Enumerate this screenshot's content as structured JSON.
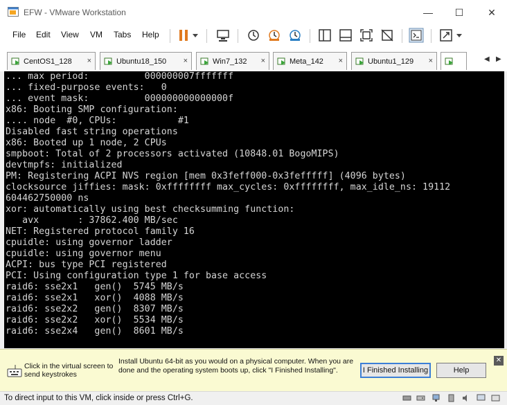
{
  "window": {
    "title": "EFW - VMware Workstation",
    "minimize_glyph": "—",
    "maximize_glyph": "☐",
    "close_glyph": "✕"
  },
  "menu": {
    "items": [
      "File",
      "Edit",
      "View",
      "VM",
      "Tabs",
      "Help"
    ]
  },
  "toolbar": {
    "icons": [
      "pause-icon",
      "dropdown-arrow-icon",
      "send-ctrl-alt-del-icon",
      "snapshot-icon",
      "revert-snapshot-icon",
      "snapshot-manager-icon",
      "show-library-icon",
      "thumbnail-view-icon",
      "full-screen-icon",
      "unity-icon",
      "console-view-icon",
      "stretch-guest-icon",
      "dropdown-arrow-icon"
    ],
    "accent_color": "#e07a1f"
  },
  "tabs": [
    {
      "label": "CentOS1_128"
    },
    {
      "label": "Ubuntu18_150"
    },
    {
      "label": "Win7_132"
    },
    {
      "label": "Meta_142"
    },
    {
      "label": "Ubuntu1_129"
    },
    {
      "label": ""
    }
  ],
  "tab_close_glyph": "×",
  "tab_nav": {
    "left": "◀",
    "right": "▶"
  },
  "console": {
    "lines": [
      "... max period:          000000007fffffff",
      "... fixed-purpose events:   0",
      "... event mask:          000000000000000f",
      "x86: Booting SMP configuration:",
      ".... node  #0, CPUs:           #1",
      "Disabled fast string operations",
      "x86: Booted up 1 node, 2 CPUs",
      "smpboot: Total of 2 processors activated (10848.01 BogoMIPS)",
      "devtmpfs: initialized",
      "PM: Registering ACPI NVS region [mem 0x3feff000-0x3fefffff] (4096 bytes)",
      "clocksource jiffies: mask: 0xffffffff max_cycles: 0xffffffff, max_idle_ns: 19112",
      "604462750000 ns",
      "xor: automatically using best checksumming function:",
      "   avx       : 37862.400 MB/sec",
      "NET: Registered protocol family 16",
      "cpuidle: using governor ladder",
      "cpuidle: using governor menu",
      "ACPI: bus type PCI registered",
      "PCI: Using configuration type 1 for base access",
      "raid6: sse2x1   gen()  5745 MB/s",
      "raid6: sse2x1   xor()  4088 MB/s",
      "raid6: sse2x2   gen()  8307 MB/s",
      "raid6: sse2x2   xor()  5534 MB/s",
      "raid6: sse2x4   gen()  8601 MB/s"
    ]
  },
  "hint": {
    "click_text": "Click in the virtual screen to send keystrokes",
    "message": "Install Ubuntu 64-bit as you would on a physical computer. When you are done and the operating system boots up, click \"I Finished Installing\".",
    "finished_button": "I Finished Installing",
    "help_button": "Help",
    "close_glyph": "✕"
  },
  "statusbar": {
    "text": "To direct input to this VM, click inside or press Ctrl+G.",
    "icons": [
      "hard-disk-icon",
      "network-icon",
      "usb-icon",
      "sound-icon",
      "display-icon",
      "message-icon"
    ]
  }
}
